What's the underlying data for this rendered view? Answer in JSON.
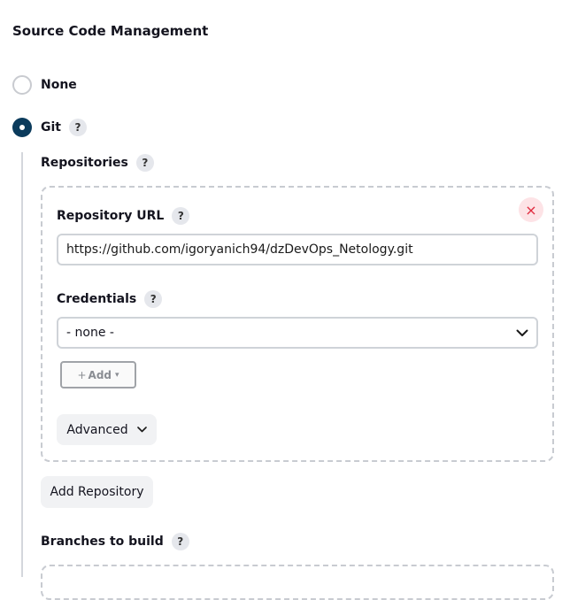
{
  "section": {
    "title": "Source Code Management"
  },
  "scm_options": [
    {
      "label": "None",
      "selected": false
    },
    {
      "label": "Git",
      "selected": true,
      "help": "?"
    }
  ],
  "repositories": {
    "label": "Repositories",
    "help": "?",
    "close_icon": "×",
    "repo_url": {
      "label": "Repository URL",
      "help": "?",
      "value": "https://github.com/igoryanich94/dzDevOps_Netology.git"
    },
    "credentials": {
      "label": "Credentials",
      "help": "?",
      "selected": "- none -",
      "add_plus": "+",
      "add_label": "Add",
      "add_caret": "▾"
    },
    "advanced_label": "Advanced"
  },
  "add_repository_label": "Add Repository",
  "branches": {
    "label": "Branches to build",
    "help": "?"
  },
  "colors": {
    "accent": "#0b3b5c",
    "danger": "#e0293d",
    "danger_bg": "#fde3e6",
    "border": "#cfd3d8",
    "button_bg": "#f1f2f4"
  },
  "icons": {
    "close": "close-icon",
    "select_chevron": "chevron-down-icon",
    "advanced_chevron": "chevron-down-icon",
    "help": "help-icon"
  }
}
